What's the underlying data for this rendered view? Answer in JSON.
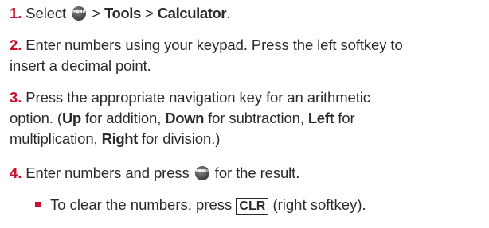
{
  "steps": [
    {
      "number": "1.",
      "parts": {
        "pre": "Select",
        "sep1": " > ",
        "tools": "Tools",
        "sep2": " > ",
        "calculator": "Calculator",
        "end": "."
      }
    },
    {
      "number": "2.",
      "line1": "Enter numbers using your keypad. Press the left softkey to",
      "line2": "insert a decimal point."
    },
    {
      "number": "3.",
      "line1": "Press the appropriate navigation key for an arithmetic",
      "line2_pre": "option. (",
      "up": "Up",
      "line2_mid1": " for addition, ",
      "down": "Down",
      "line2_mid2": " for subtraction, ",
      "left": "Left",
      "line2_end": " for",
      "line3_pre": "multiplication, ",
      "right": "Right",
      "line3_end": " for division.)"
    },
    {
      "number": "4.",
      "pre": "Enter numbers and press",
      "post": " for the result."
    }
  ],
  "bullet": {
    "pre": "To clear the numbers, press ",
    "key": "CLR",
    "post": " (right softkey)."
  },
  "icons": {
    "menu_ok_line1": "MENU",
    "menu_ok_line2": "OK"
  },
  "colors": {
    "accent": "#c8102e",
    "text": "#2b2b2b"
  }
}
